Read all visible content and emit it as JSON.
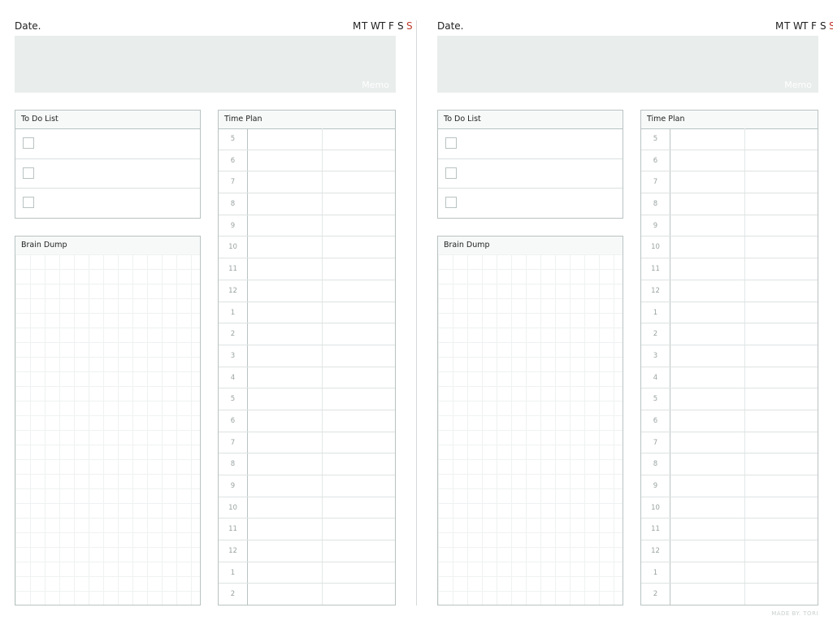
{
  "pages": [
    {
      "date_label": "Date.",
      "weekdays": [
        "M",
        "T",
        "W",
        "T",
        "F",
        "S",
        "S"
      ],
      "memo_label": "Memo",
      "todo_title": "To Do List",
      "brain_title": "Brain Dump",
      "time_title": "Time Plan",
      "hours": [
        "5",
        "6",
        "7",
        "8",
        "9",
        "10",
        "11",
        "12",
        "1",
        "2",
        "3",
        "4",
        "5",
        "6",
        "7",
        "8",
        "9",
        "10",
        "11",
        "12",
        "1",
        "2"
      ]
    },
    {
      "date_label": "Date.",
      "weekdays": [
        "M",
        "T",
        "W",
        "T",
        "F",
        "S",
        "S"
      ],
      "memo_label": "Memo",
      "todo_title": "To Do List",
      "brain_title": "Brain Dump",
      "time_title": "Time Plan",
      "hours": [
        "5",
        "6",
        "7",
        "8",
        "9",
        "10",
        "11",
        "12",
        "1",
        "2",
        "3",
        "4",
        "5",
        "6",
        "7",
        "8",
        "9",
        "10",
        "11",
        "12",
        "1",
        "2"
      ]
    }
  ],
  "footer": {
    "made_by": "MADE BY. TORI"
  },
  "colors": {
    "sunday": "#c0392b",
    "memo_bg": "#e9edec",
    "border": "#b9c3c2"
  }
}
